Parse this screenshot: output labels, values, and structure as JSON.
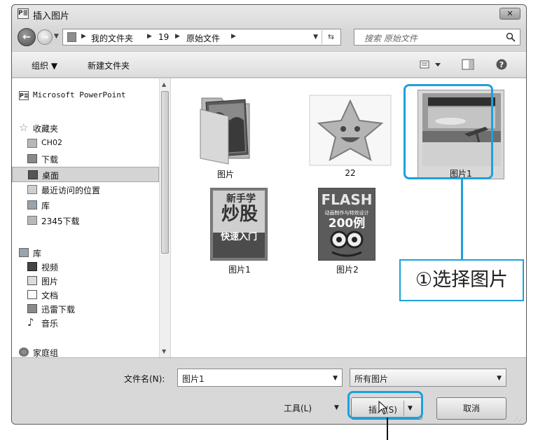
{
  "window": {
    "title": "插入图片",
    "app_icon": "P≣",
    "close": "✕"
  },
  "address": {
    "crumbs": [
      "我的文件夹",
      "19",
      "原始文件"
    ],
    "search_placeholder": "搜索 原始文件"
  },
  "toolbar": {
    "organize": "组织 ▼",
    "new_folder": "新建文件夹"
  },
  "nav": {
    "items": [
      {
        "label": "Microsoft PowerPoint",
        "icon": "powerpoint-icon"
      },
      {
        "label": "收藏夹",
        "icon": "star-icon"
      },
      {
        "label": "CH02",
        "icon": "folder-icon"
      },
      {
        "label": "下载",
        "icon": "download-folder-icon"
      },
      {
        "label": "桌面",
        "icon": "desktop-icon",
        "selected": true
      },
      {
        "label": "最近访问的位置",
        "icon": "recent-places-icon"
      },
      {
        "label": "库",
        "icon": "library-icon"
      },
      {
        "label": "2345下载",
        "icon": "folder-icon"
      },
      {
        "label": "库",
        "icon": "library-icon"
      },
      {
        "label": "视频",
        "icon": "video-icon"
      },
      {
        "label": "图片",
        "icon": "pictures-icon"
      },
      {
        "label": "文档",
        "icon": "documents-icon"
      },
      {
        "label": "迅雷下载",
        "icon": "download-folder-icon"
      },
      {
        "label": "音乐",
        "icon": "music-icon"
      },
      {
        "label": "家庭组",
        "icon": "homegroup-icon"
      }
    ]
  },
  "files": [
    {
      "label": "图片",
      "kind": "folder"
    },
    {
      "label": "22",
      "kind": "star-image"
    },
    {
      "label": "图片1",
      "kind": "lamp-photo",
      "selected": true
    },
    {
      "label": "图片1",
      "kind": "book-cover-stock"
    },
    {
      "label": "图片2",
      "kind": "book-cover-flash"
    }
  ],
  "covers": {
    "stock_line1": "新手学",
    "stock_line2": "炒股",
    "stock_line3": "快速入门",
    "flash_line1": "FLASH",
    "flash_line2": "动画制作与特效设计",
    "flash_line3": "200例"
  },
  "footer": {
    "filename_label": "文件名(N):",
    "filename_value": "图片1",
    "filetype_value": "所有图片",
    "tools_label": "工具(L)",
    "insert_label": "插入(S)",
    "cancel_label": "取消"
  },
  "annotation": {
    "callout": "①选择图片"
  },
  "colors": {
    "highlight": "#1ea0dc"
  }
}
